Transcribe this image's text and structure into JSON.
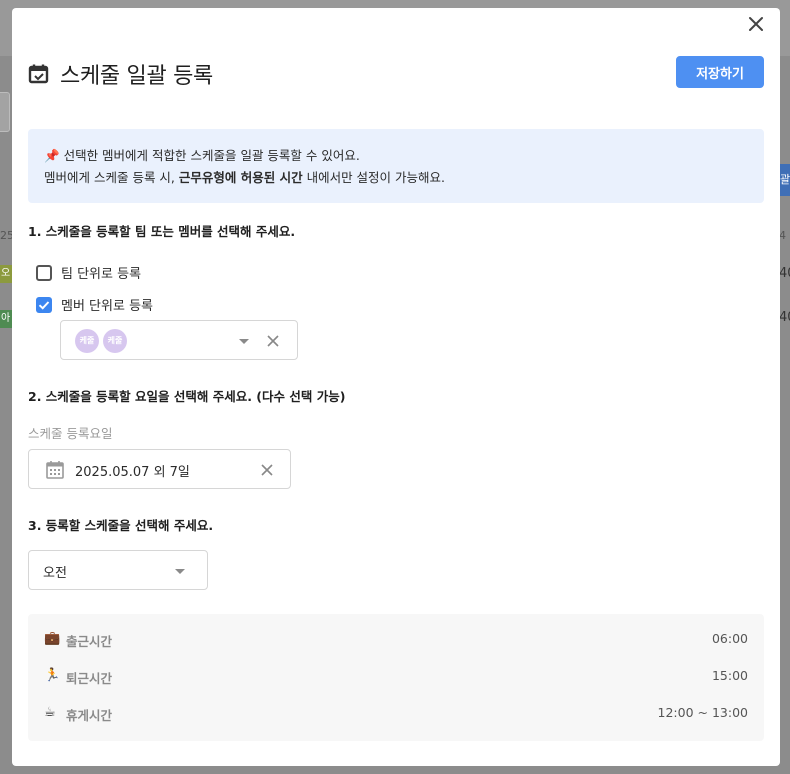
{
  "background": {
    "fragment_1": "25.",
    "fragment_2": "오",
    "fragment_3": "아",
    "fragment_4": "괄",
    "fragment_5": "40",
    "fragment_6": "40",
    "fragment_7": "4"
  },
  "modal": {
    "title": "스케줄 일괄 등록",
    "save_label": "저장하기",
    "notice": {
      "pin_emoji": "📌",
      "line1": "선택한 멤버에게 적합한 스케줄을 일괄 등록할 수 있어요.",
      "line2_pre": "멤버에게 스케줄 등록 시, ",
      "line2_bold": "근무유형에 허용된 시간",
      "line2_post": " 내에서만 설정이 가능해요."
    },
    "step1": {
      "title": "1. 스케줄을 등록할 팀 또는 멤버를 선택해 주세요.",
      "option_team": "팀 단위로 등록",
      "option_member": "멤버 단위로 등록",
      "avatars": [
        "케줄",
        "케줄"
      ]
    },
    "step2": {
      "title": "2. 스케줄을 등록할 요일을 선택해 주세요. (다수 선택 가능)",
      "field_label": "스케줄 등록요일",
      "date_value": "2025.05.07 외 7일"
    },
    "step3": {
      "title": "3. 등록할 스케줄을 선택해 주세요.",
      "selected_schedule": "오전"
    },
    "info": [
      {
        "emoji": "💼",
        "label": "출근시간",
        "value": "06:00"
      },
      {
        "emoji": "🏃",
        "label": "퇴근시간",
        "value": "15:00"
      },
      {
        "emoji": "☕",
        "label": "휴게시간",
        "value": "12:00 ~ 13:00"
      }
    ]
  },
  "colors": {
    "primary": "#4e90f2",
    "notice_bg": "#eaf1fd",
    "checkbox_checked": "#3c86f0",
    "avatar": "#d7c7ef",
    "info_bg": "#f7f7f7"
  }
}
